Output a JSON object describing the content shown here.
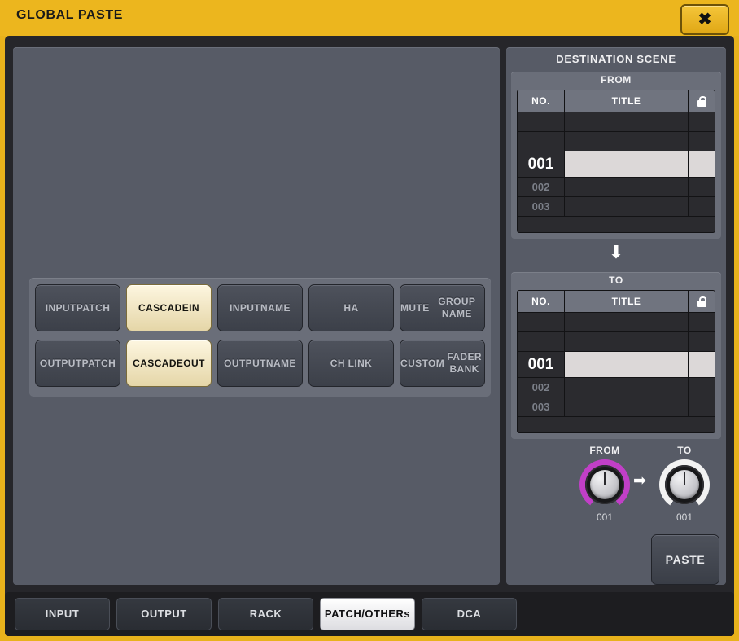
{
  "window": {
    "title": "GLOBAL PASTE",
    "close_label": "✖",
    "close_icon": "close-icon"
  },
  "buttons": {
    "row1": [
      {
        "label": "INPUT\nPATCH",
        "state": "off"
      },
      {
        "label": "CASCADE\nIN",
        "state": "on"
      },
      {
        "label": "INPUT\nNAME",
        "state": "off"
      },
      {
        "label": "HA",
        "state": "off"
      },
      {
        "label": "MUTE\nGROUP NAME",
        "state": "off"
      }
    ],
    "row2": [
      {
        "label": "OUTPUT\nPATCH",
        "state": "off"
      },
      {
        "label": "CASCADE\nOUT",
        "state": "on"
      },
      {
        "label": "OUTPUT\nNAME",
        "state": "off"
      },
      {
        "label": "CH LINK",
        "state": "off"
      },
      {
        "label": "CUSTOM\nFADER BANK",
        "state": "off"
      }
    ]
  },
  "destination": {
    "header": "DESTINATION SCENE",
    "arrow": "⬇",
    "columns": {
      "no": "NO.",
      "title": "TITLE",
      "lock": "lock-icon"
    },
    "from": {
      "label": "FROM",
      "rows": [
        {
          "no": "",
          "title": "",
          "state": "blank"
        },
        {
          "no": "",
          "title": "",
          "state": "blank"
        },
        {
          "no": "001",
          "title": "",
          "state": "selected"
        },
        {
          "no": "002",
          "title": "",
          "state": "dim"
        },
        {
          "no": "003",
          "title": "",
          "state": "dim"
        }
      ]
    },
    "to": {
      "label": "TO",
      "rows": [
        {
          "no": "",
          "title": "",
          "state": "blank"
        },
        {
          "no": "",
          "title": "",
          "state": "blank"
        },
        {
          "no": "001",
          "title": "",
          "state": "selected"
        },
        {
          "no": "002",
          "title": "",
          "state": "dim"
        },
        {
          "no": "003",
          "title": "",
          "state": "dim"
        }
      ]
    }
  },
  "knobs": {
    "from": {
      "label": "FROM",
      "value": "001",
      "color": "#c13fc7"
    },
    "to": {
      "label": "TO",
      "value": "001",
      "color": "#f2f2f2"
    },
    "arrow": "➡"
  },
  "paste": {
    "label": "PASTE"
  },
  "tabs": [
    {
      "label": "INPUT",
      "active": false
    },
    {
      "label": "OUTPUT",
      "active": false
    },
    {
      "label": "RACK",
      "active": false
    },
    {
      "label": "PATCH\n/OTHERs",
      "active": true
    },
    {
      "label": "DCA",
      "active": false
    }
  ]
}
